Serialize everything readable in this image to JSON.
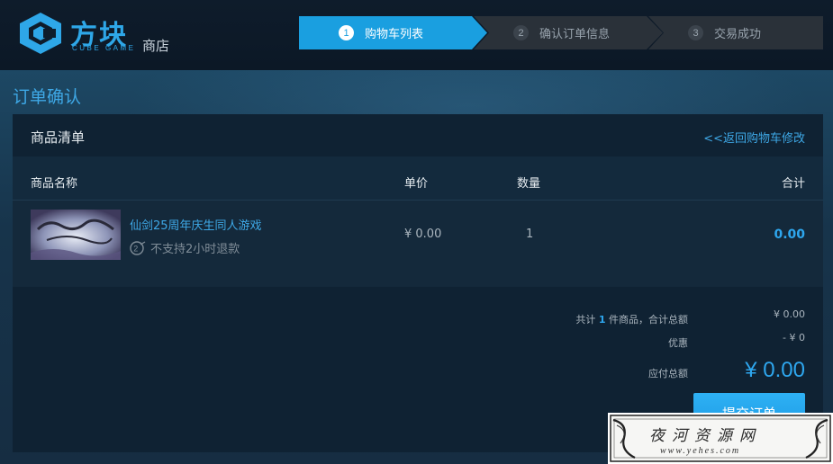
{
  "header": {
    "brand_cn": "方块",
    "brand_en": "CUBE GAME",
    "store_label": "商店",
    "colors": {
      "accent": "#2ea7e8",
      "step_active": "#1a9fe0",
      "header_bg": "#0e1c2b"
    }
  },
  "steps": [
    {
      "num": "1",
      "label": "购物车列表",
      "active": true
    },
    {
      "num": "2",
      "label": "确认订单信息",
      "active": false
    },
    {
      "num": "3",
      "label": "交易成功",
      "active": false
    }
  ],
  "page": {
    "title": "订单确认"
  },
  "panel": {
    "title": "商品清单",
    "back_link": "<<返回购物车修改"
  },
  "columns": {
    "name": "商品名称",
    "price": "单价",
    "qty": "数量",
    "total": "合计"
  },
  "items": [
    {
      "name": "仙剑25周年庆生同人游戏",
      "refund_note": "不支持2小时退款",
      "refund_icon": "no-refund-icon",
      "price": "¥ 0.00",
      "qty": "1",
      "total": "0.00"
    }
  ],
  "summary": {
    "count_prefix": "共计",
    "count": "1",
    "count_suffix": "件商品，合计总额",
    "subtotal": "¥ 0.00",
    "discount_label": "优惠",
    "discount": "- ¥ 0",
    "payable_label": "应付总额",
    "payable": "¥ 0.00",
    "submit_label": "提交订单"
  },
  "watermark": {
    "cn": "夜河资源网",
    "en": "www.yehes.com"
  }
}
